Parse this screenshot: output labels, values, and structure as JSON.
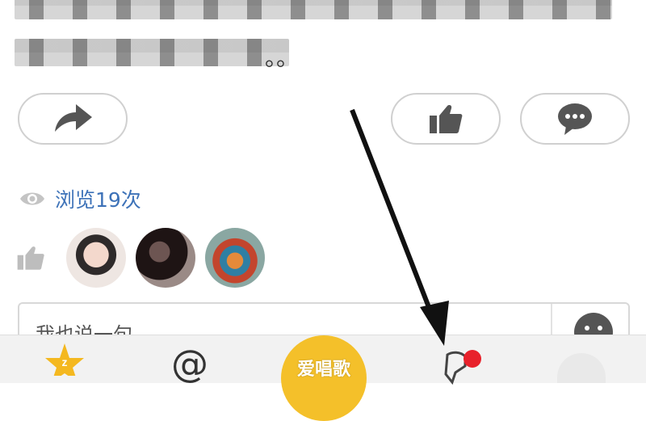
{
  "post": {
    "visible_text_tail": "。。"
  },
  "actions": {
    "share_icon": "share-arrow-icon",
    "like_icon": "thumbs-up-icon",
    "comment_icon": "speech-bubble-icon"
  },
  "views": {
    "icon": "eye-icon",
    "label": "浏览19次"
  },
  "likers": {
    "icon": "thumbs-up-icon",
    "avatars": [
      "avatar-1",
      "avatar-2",
      "avatar-3"
    ]
  },
  "comment_input": {
    "placeholder": "我也说一句",
    "emoji_icon": "smiley-icon"
  },
  "tabbar": {
    "center_label": "爱唱歌",
    "at_symbol": "@",
    "message_badge_color": "#e8212b",
    "center_color": "#f4c02a"
  },
  "colors": {
    "link": "#3d72b8",
    "border": "#d0d0d0"
  }
}
